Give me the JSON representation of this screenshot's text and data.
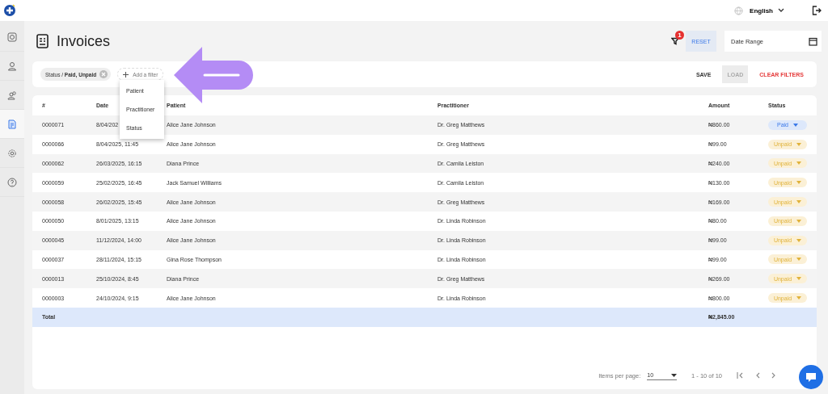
{
  "topbar": {
    "language": "English"
  },
  "sidebar": {
    "items": [
      {
        "selected": false
      },
      {
        "selected": false
      },
      {
        "selected": false
      },
      {
        "selected": true
      },
      {
        "selected": false
      },
      {
        "selected": false
      }
    ]
  },
  "header": {
    "title": "Invoices",
    "filter_count": "1",
    "reset": "RESET",
    "date_range": {
      "placeholder": "Date Range"
    }
  },
  "filters": {
    "chip": {
      "field": "Status / ",
      "values": "Paid, Unpaid"
    },
    "add": "Add a filter",
    "save": "SAVE",
    "load": "LOAD",
    "load_disabled": true,
    "clear": "CLEAR FILTERS",
    "menu": [
      "Patient",
      "Practitioner",
      "Status"
    ]
  },
  "table": {
    "columns": [
      "#",
      "Date",
      "Patient",
      "Practitioner",
      "Amount",
      "Status"
    ],
    "rows": [
      {
        "id": "0000071",
        "date": "8/04/202",
        "patient": "Alice Jane Johnson",
        "practitioner": "Dr. Greg Matthews",
        "amount": "₦860.00",
        "status": {
          "label": "Paid",
          "kind": "paid"
        }
      },
      {
        "id": "0000066",
        "date": "8/04/2025, 11:45",
        "patient": "Alice Jane Johnson",
        "practitioner": "Dr. Greg Matthews",
        "amount": "₦99.00",
        "status": {
          "label": "Unpaid",
          "kind": "unpaid"
        }
      },
      {
        "id": "0000062",
        "date": "26/03/2025, 16:15",
        "patient": "Diana Prince",
        "practitioner": "Dr. Camila Leiston",
        "amount": "₦240.00",
        "status": {
          "label": "Unpaid",
          "kind": "unpaid"
        }
      },
      {
        "id": "0000059",
        "date": "25/02/2025, 16:45",
        "patient": "Jack Samuel Williams",
        "practitioner": "Dr. Camila Leiston",
        "amount": "₦130.00",
        "status": {
          "label": "Unpaid",
          "kind": "unpaid"
        }
      },
      {
        "id": "0000058",
        "date": "26/02/2025, 15:45",
        "patient": "Alice Jane Johnson",
        "practitioner": "Dr. Greg Matthews",
        "amount": "₦169.00",
        "status": {
          "label": "Unpaid",
          "kind": "unpaid"
        }
      },
      {
        "id": "0000050",
        "date": "8/01/2025, 13:15",
        "patient": "Alice Jane Johnson",
        "practitioner": "Dr. Linda Robinson",
        "amount": "₦80.00",
        "status": {
          "label": "Unpaid",
          "kind": "unpaid"
        }
      },
      {
        "id": "0000045",
        "date": "11/12/2024, 14:00",
        "patient": "Alice Jane Johnson",
        "practitioner": "Dr. Linda Robinson",
        "amount": "₦99.00",
        "status": {
          "label": "Unpaid",
          "kind": "unpaid"
        }
      },
      {
        "id": "0000037",
        "date": "28/11/2024, 15:15",
        "patient": "Gina Rose Thompson",
        "practitioner": "Dr. Linda Robinson",
        "amount": "₦99.00",
        "status": {
          "label": "Unpaid",
          "kind": "unpaid"
        }
      },
      {
        "id": "0000013",
        "date": "25/10/2024, 8:45",
        "patient": "Diana Prince",
        "practitioner": "Dr. Greg Matthews",
        "amount": "₦269.00",
        "status": {
          "label": "Unpaid",
          "kind": "unpaid"
        }
      },
      {
        "id": "0000003",
        "date": "24/10/2024, 9:15",
        "patient": "Alice Jane Johnson",
        "practitioner": "Dr. Linda Robinson",
        "amount": "₦800.00",
        "status": {
          "label": "Unpaid",
          "kind": "unpaid"
        }
      }
    ],
    "total": {
      "label": "Total",
      "amount": "₦2,845.00"
    }
  },
  "pagination": {
    "items_label": "Items per page:",
    "per_page": "10",
    "range": "1 - 10 of 10"
  }
}
